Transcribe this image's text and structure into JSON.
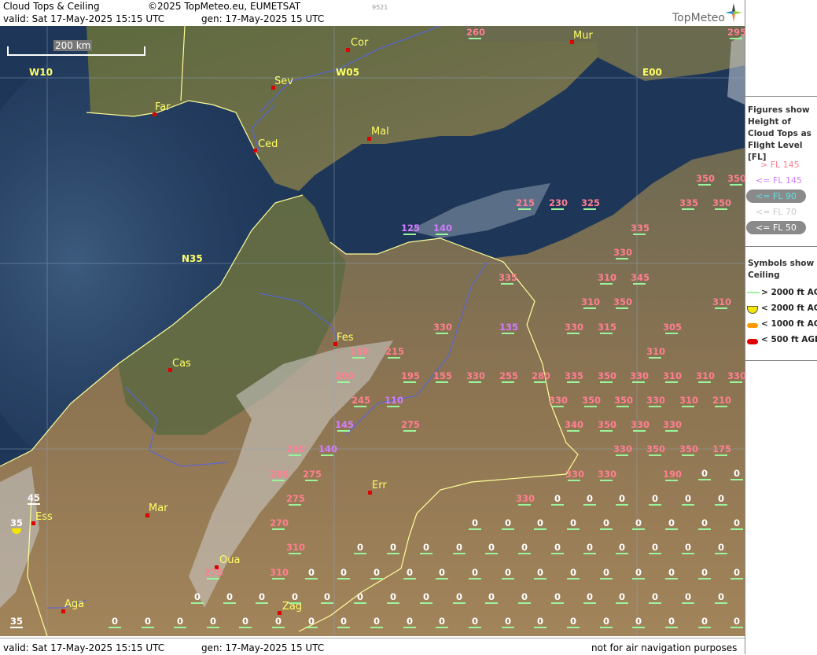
{
  "header": {
    "product": "Cloud Tops & Ceiling",
    "copyright": "©2025 TopMeteo.eu, EUMETSAT",
    "valid_line": "valid:  Sat  17-May-2025  15:15 UTC",
    "gen_line": "gen: 17-May-2025 15 UTC",
    "small_code": "9521",
    "logo": "TopMeteo"
  },
  "footer": {
    "valid_line": "valid:  Sat  17-May-2025  15:15 UTC",
    "gen_line": "gen: 17-May-2025 15 UTC",
    "disclaimer": "not for air navigation purposes"
  },
  "map": {
    "scale_label": "200 km",
    "grid_labels": {
      "w10": "W10",
      "w05": "W05",
      "e00": "E00",
      "n35": "N35"
    },
    "cities": [
      {
        "id": "cor",
        "name": "Cor"
      },
      {
        "id": "mur",
        "name": "Mur"
      },
      {
        "id": "sev",
        "name": "Sev"
      },
      {
        "id": "far",
        "name": "Far"
      },
      {
        "id": "ced",
        "name": "Ced"
      },
      {
        "id": "mal",
        "name": "Mal"
      },
      {
        "id": "fes",
        "name": "Fes"
      },
      {
        "id": "cas",
        "name": "Cas"
      },
      {
        "id": "err",
        "name": "Err"
      },
      {
        "id": "mar",
        "name": "Mar"
      },
      {
        "id": "ess",
        "name": "Ess"
      },
      {
        "id": "oua",
        "name": "Oua"
      },
      {
        "id": "aga",
        "name": "Aga"
      },
      {
        "id": "zag",
        "name": "Zag"
      }
    ],
    "cloud_tops_gt145": [
      "260",
      "295",
      "215",
      "230",
      "325",
      "350",
      "350",
      "335",
      "350",
      "335",
      "330",
      "335",
      "310",
      "345",
      "310",
      "310",
      "350",
      "330",
      "330",
      "315",
      "305",
      "310",
      "200",
      "195",
      "155",
      "330",
      "255",
      "280",
      "335",
      "350",
      "330",
      "310",
      "310",
      "330",
      "245",
      "330",
      "350",
      "350",
      "330",
      "310",
      "210",
      "275",
      "340",
      "350",
      "330",
      "330",
      "240",
      "330",
      "350",
      "350",
      "175",
      "280",
      "275",
      "330",
      "330",
      "190",
      "330",
      "275",
      "270",
      "310",
      "275",
      "310",
      "150",
      "215"
    ],
    "cloud_tops_le145": [
      "125",
      "140",
      "135",
      "110",
      "145",
      "140"
    ],
    "ceiling_labels": [
      "45",
      "35",
      "35"
    ],
    "ceiling_zero": "0"
  },
  "legend": {
    "figures_title": "Figures show Height of Cloud Tops as Flight Level  [FL]",
    "fl_items": [
      {
        "label": "> FL 145",
        "color": "#ff7f90"
      },
      {
        "label": "<= FL 145",
        "color": "#d47bff"
      },
      {
        "label": "<= FL 90",
        "color": "#5fe0e0"
      },
      {
        "label": "<= FL 70",
        "color": "#c8c8c8"
      },
      {
        "label": "<= FL 50",
        "color": "#ffffff"
      }
    ],
    "symbols_title": "Symbols show Ceiling",
    "symbol_items": [
      {
        "label": "> 2000 ft AGL",
        "color": "#9cf59c"
      },
      {
        "label": "< 2000 ft AGL",
        "color": "#f5e600"
      },
      {
        "label": "< 1000 ft AGL",
        "color": "#ff9a00"
      },
      {
        "label": "< 500 ft AGL",
        "color": "#e00000"
      }
    ]
  },
  "colors": {
    "tops_high": "#ff7f90",
    "tops_mid": "#d47bff",
    "ceiling_ok": "#9cf59c",
    "city_label": "#ffff66",
    "border": "#ffff99",
    "river": "#5566dd"
  }
}
